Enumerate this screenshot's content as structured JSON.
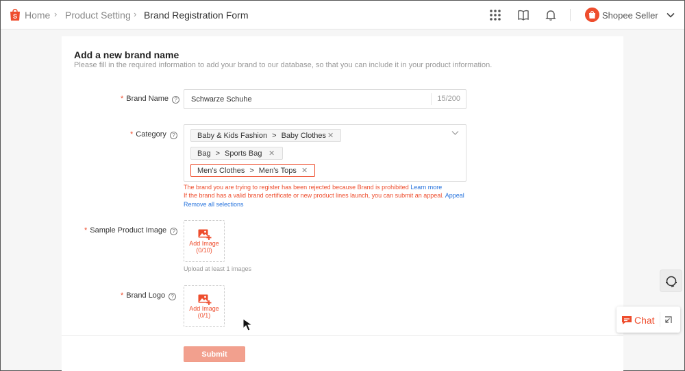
{
  "breadcrumb": {
    "home": "Home",
    "product_setting": "Product Setting",
    "current": "Brand Registration Form"
  },
  "topbar": {
    "seller_label": "Shopee Seller",
    "icons": [
      "apps-grid-icon",
      "book-icon",
      "bell-icon",
      "chevron-down-icon"
    ]
  },
  "form": {
    "title": "Add a new brand name",
    "subtitle": "Please fill in the required information to add your brand to our database, so that you can include it in your product information.",
    "brand_name": {
      "label": "Brand Name",
      "value": "Schwarze Schuhe",
      "count": "15/200"
    },
    "category": {
      "label": "Category",
      "tags": [
        {
          "parent": "Baby & Kids Fashion",
          "child": "Baby Clothes"
        },
        {
          "parent": "Bag",
          "child": "Sports Bag"
        },
        {
          "parent": "Men's Clothes",
          "child": "Men's Tops"
        }
      ],
      "error_1": "The brand you are trying to register has been rejected because Brand is prohibited",
      "learn_more": "Learn more",
      "error_2": "If the brand has a valid brand certificate or new product lines launch, you can submit an appeal.",
      "appeal": "Appeal",
      "remove_all": "Remove all selections"
    },
    "sample_image": {
      "label": "Sample Product Image",
      "add_text": "Add Image",
      "count": "(0/10)",
      "hint": "Upload at least 1 images"
    },
    "brand_logo": {
      "label": "Brand Logo",
      "add_text": "Add Image",
      "count": "(0/1)"
    },
    "submit_label": "Submit"
  },
  "chat": {
    "label": "Chat"
  },
  "colors": {
    "brand": "#ee4d2d",
    "link": "#2673dd",
    "submit_disabled": "#f2a08e"
  }
}
